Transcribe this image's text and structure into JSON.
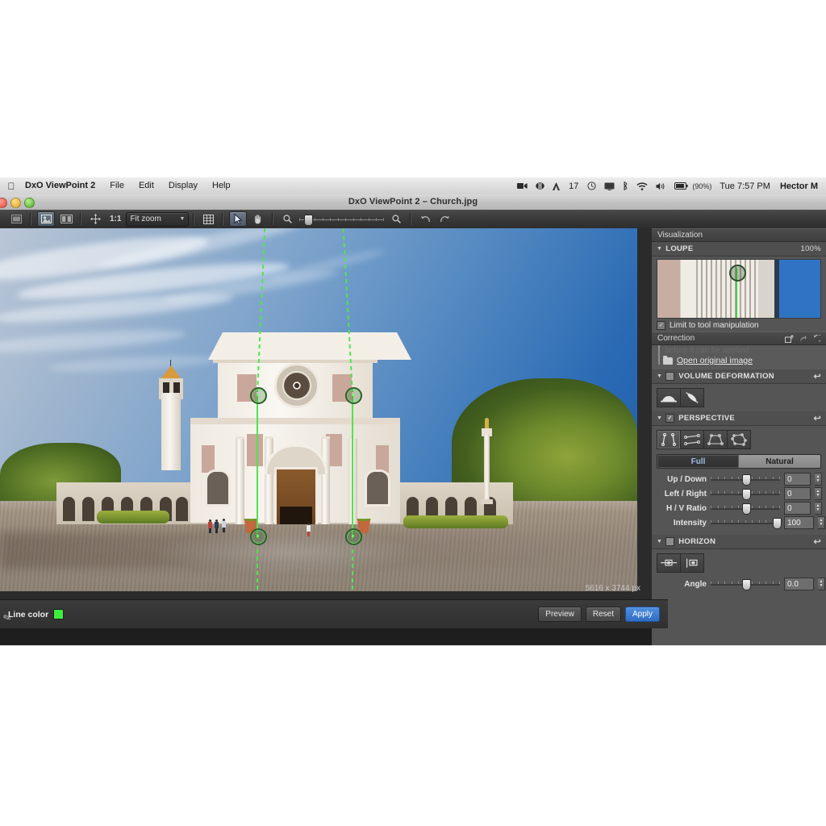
{
  "menubar": {
    "apple": "",
    "items": [
      {
        "label": "DxO ViewPoint 2",
        "bold": true
      },
      {
        "label": "File",
        "bold": false
      },
      {
        "label": "Edit",
        "bold": false
      },
      {
        "label": "Display",
        "bold": false
      },
      {
        "label": "Help",
        "bold": false
      }
    ],
    "status": {
      "screencast_icon": "screen-record-icon",
      "dropbox_icon": "dropbox-icon",
      "alfred_count": "17",
      "clock_icon": "time-machine-icon",
      "display_icon": "display-icon",
      "bluetooth_icon": "bluetooth-icon",
      "wifi_icon": "wifi-icon",
      "volume_icon": "volume-icon",
      "battery_percent": "(90%)",
      "time": "Tue 7:57 PM",
      "user": "Hector M"
    }
  },
  "window": {
    "title": "DxO ViewPoint 2 – Church.jpg"
  },
  "toolbar": {
    "filmstrip": "filmstrip-icon",
    "single_view": "single-image-view-icon",
    "compare_view": "compare-view-icon",
    "pan_tool": "move-tool-icon",
    "zoom_1to1": "1:1",
    "zoom_mode": "Fit zoom",
    "grid": "grid-icon",
    "select_tool": "arrow-select-icon",
    "hand_tool": "hand-tool-icon",
    "zoom_out_icon": "zoom-out-icon",
    "zoom_in_icon": "zoom-in-icon",
    "undo": "undo-icon",
    "redo": "redo-icon"
  },
  "canvas": {
    "image_size": "5616 x 3744 px",
    "guides": [
      {
        "name": "perspective-guide-left"
      },
      {
        "name": "perspective-guide-right"
      }
    ]
  },
  "panel": {
    "visualization": {
      "title": "Visualization"
    },
    "loupe": {
      "title": "LOUPE",
      "zoom": "100%",
      "limit_label": "Limit to tool manipulation",
      "limit_checked": true
    },
    "correction": {
      "title": "Correction",
      "cut_text": "before it can be applied:",
      "open_original": "Open original image",
      "export_icon": "export-icon",
      "copy_icon": "copy-icon",
      "reset_icon": "reset-icon"
    },
    "volume_deformation": {
      "title": "VOLUME DEFORMATION",
      "enabled": false,
      "tools": [
        "volume-horizontal-icon",
        "volume-diagonal-icon"
      ]
    },
    "perspective": {
      "title": "PERSPECTIVE",
      "enabled": true,
      "tools": [
        "two-lines-vertical-icon",
        "two-lines-horizontal-icon",
        "four-point-rectangle-icon",
        "eight-point-icon"
      ],
      "modes": [
        {
          "label": "Full",
          "selected": true
        },
        {
          "label": "Natural",
          "selected": false
        }
      ],
      "sliders": [
        {
          "label": "Up / Down",
          "value": "0",
          "pos": 50
        },
        {
          "label": "Left / Right",
          "value": "0",
          "pos": 50
        },
        {
          "label": "H / V Ratio",
          "value": "0",
          "pos": 50
        },
        {
          "label": "Intensity",
          "value": "100",
          "pos": 97
        }
      ]
    },
    "horizon": {
      "title": "HORIZON",
      "enabled": false,
      "tools": [
        "horizon-horizontal-icon",
        "horizon-vertical-icon"
      ],
      "sliders": [
        {
          "label": "Angle",
          "value": "0.0",
          "pos": 50
        }
      ]
    }
  },
  "bottombar": {
    "pen_icon": "pen-icon",
    "line_color_label": "Line color",
    "line_color": "#3cf03c",
    "buttons": [
      {
        "label": "Preview",
        "primary": false
      },
      {
        "label": "Reset",
        "primary": false
      },
      {
        "label": "Apply",
        "primary": true
      }
    ]
  }
}
